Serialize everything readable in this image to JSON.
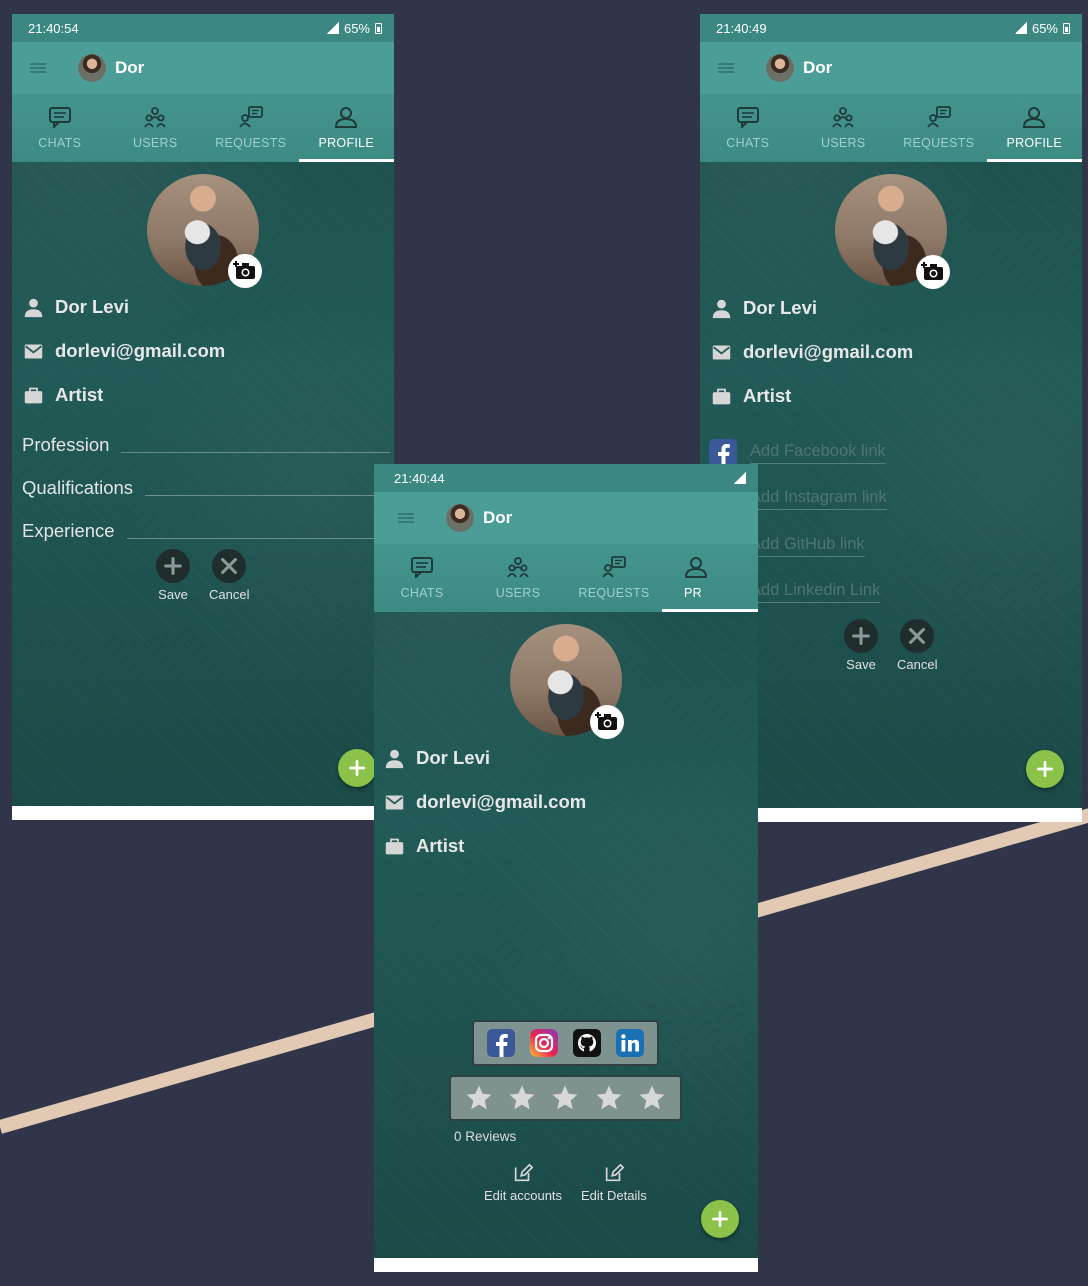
{
  "colors": {
    "background": "#31354a",
    "accent": "#8bc34a",
    "appbar": "#4b9e98",
    "statusbar": "#3b8883"
  },
  "screens": {
    "a": {
      "time": "21:40:54",
      "battery": "65%",
      "user": "Dor",
      "tabs": [
        "CHATS",
        "USERS",
        "REQUESTS",
        "PROFILE"
      ],
      "active_tab": "PROFILE",
      "name": "Dor Levi",
      "email": "dorlevi@gmail.com",
      "role": "Artist",
      "fields": [
        "Profession",
        "Qualifications",
        "Experience"
      ],
      "save": "Save",
      "cancel": "Cancel"
    },
    "b": {
      "time": "21:40:44",
      "user": "Dor",
      "tabs": [
        "CHATS",
        "USERS",
        "REQUESTS",
        "PR"
      ],
      "active_tab": "PROFILE",
      "name": "Dor Levi",
      "email": "dorlevi@gmail.com",
      "role": "Artist",
      "social_icons": [
        "facebook-icon",
        "instagram-icon",
        "github-icon",
        "linkedin-icon"
      ],
      "rating_stars": 5,
      "rating_value": 0,
      "reviews": "0 Reviews",
      "edit_accounts": "Edit accounts",
      "edit_details": "Edit Details"
    },
    "c": {
      "time": "21:40:49",
      "battery": "65%",
      "user": "Dor",
      "tabs": [
        "CHATS",
        "USERS",
        "REQUESTS",
        "PROFILE"
      ],
      "active_tab": "PROFILE",
      "name": "Dor Levi",
      "email": "dorlevi@gmail.com",
      "role": "Artist",
      "links": [
        "Add Facebook link",
        "Add Instagram link",
        "Add GitHub link",
        "Add Linkedin Link"
      ],
      "save": "Save",
      "cancel": "Cancel"
    }
  }
}
